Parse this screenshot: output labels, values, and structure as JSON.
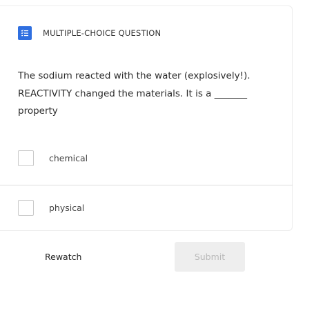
{
  "question": {
    "type_label": "MULTIPLE-CHOICE QUESTION",
    "type_icon": "checklist-icon",
    "text_line1": "The sodium reacted with the water (explosively!).",
    "text_line2": "REACTIVITY changed the materials.  It is a _______",
    "text_line3": "property"
  },
  "options": [
    {
      "label": "chemical",
      "checked": false
    },
    {
      "label": "physical",
      "checked": false
    }
  ],
  "actions": {
    "rewatch_label": "Rewatch",
    "submit_label": "Submit",
    "submit_disabled": true
  },
  "colors": {
    "accent": "#2f6fe0",
    "submit_bg_disabled": "#eeeeee",
    "submit_text_disabled": "#b9b9b9"
  }
}
